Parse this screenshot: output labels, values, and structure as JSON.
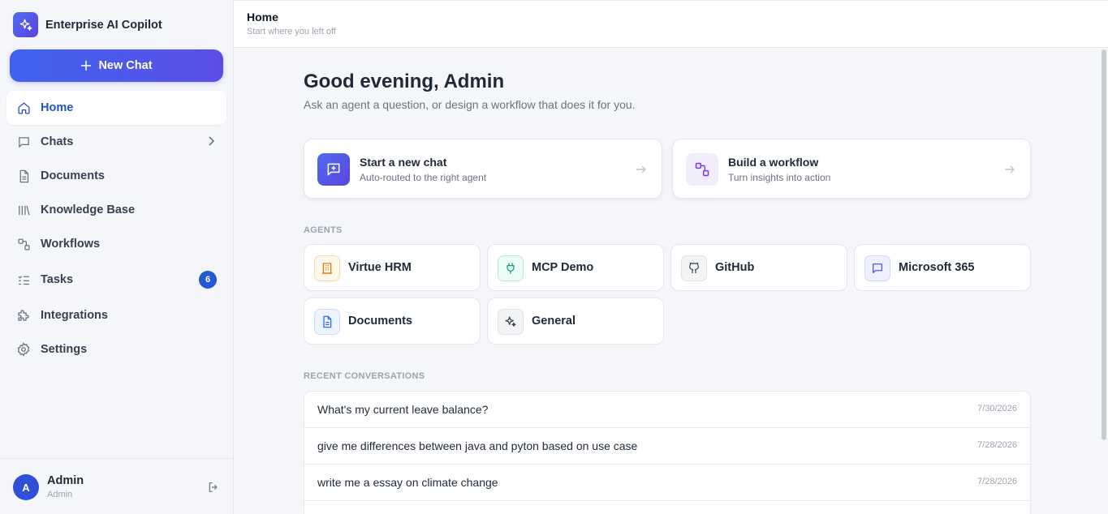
{
  "app": {
    "name": "Enterprise AI Copilot"
  },
  "sidebar": {
    "new_chat_label": "New Chat",
    "items": [
      {
        "label": "Home",
        "icon": "home-icon",
        "active": true
      },
      {
        "label": "Chats",
        "icon": "chat-icon"
      },
      {
        "label": "Documents",
        "icon": "document-icon"
      },
      {
        "label": "Knowledge Base",
        "icon": "library-icon"
      },
      {
        "label": "Workflows",
        "icon": "workflow-icon"
      },
      {
        "label": "Tasks",
        "icon": "tasks-icon",
        "badge": "6"
      },
      {
        "label": "Integrations",
        "icon": "puzzle-icon"
      },
      {
        "label": "Settings",
        "icon": "gear-icon"
      }
    ],
    "user": {
      "initial": "A",
      "name": "Admin",
      "role": "Admin"
    }
  },
  "header": {
    "title": "Home",
    "subtitle": "Start where you left off"
  },
  "main": {
    "greeting": "Good evening, Admin",
    "greeting_sub": "Ask an agent a question, or design a workflow that does it for you.",
    "quick_actions": [
      {
        "title": "Start a new chat",
        "subtitle": "Auto-routed to the right agent"
      },
      {
        "title": "Build a workflow",
        "subtitle": "Turn insights into action"
      }
    ],
    "agents_label": "AGENTS",
    "agents": [
      {
        "label": "Virtue HRM",
        "icon": "building-icon",
        "color": "#d97706"
      },
      {
        "label": "MCP Demo",
        "icon": "plug-icon",
        "color": "#059669"
      },
      {
        "label": "GitHub",
        "icon": "github-icon",
        "color": "#374151"
      },
      {
        "label": "Microsoft 365",
        "icon": "message-icon",
        "color": "#4f46e5"
      },
      {
        "label": "Documents",
        "icon": "document-icon",
        "color": "#2563eb"
      },
      {
        "label": "General",
        "icon": "sparkle-icon",
        "color": "#374151"
      }
    ],
    "recent_label": "RECENT CONVERSATIONS",
    "recent": [
      {
        "title": "What's my current leave balance?",
        "date": "7/30/2026"
      },
      {
        "title": "give me differences between java and pyton based on use case",
        "date": "7/28/2026"
      },
      {
        "title": "write me a essay on climate change",
        "date": "7/28/2026"
      }
    ]
  }
}
